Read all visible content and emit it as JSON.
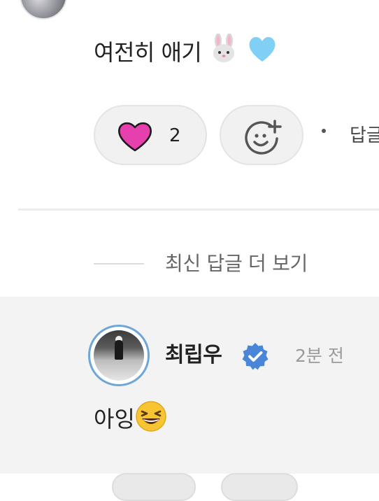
{
  "comment": {
    "text": "여전히 애기",
    "emojis": "🐰🩵"
  },
  "actions": {
    "like_count": "2",
    "dot": "·",
    "reply_label": "답글"
  },
  "more_replies": {
    "label": "최신 답글 더 보기"
  },
  "reply": {
    "author": "최립우",
    "time": "2분 전",
    "text": "아잉",
    "emoji": "😆"
  },
  "colors": {
    "heart": "#e63fae",
    "verified": "#4a86d8",
    "avatar_ring": "#6fa6d6",
    "reply_bg": "#f3f3f3"
  }
}
